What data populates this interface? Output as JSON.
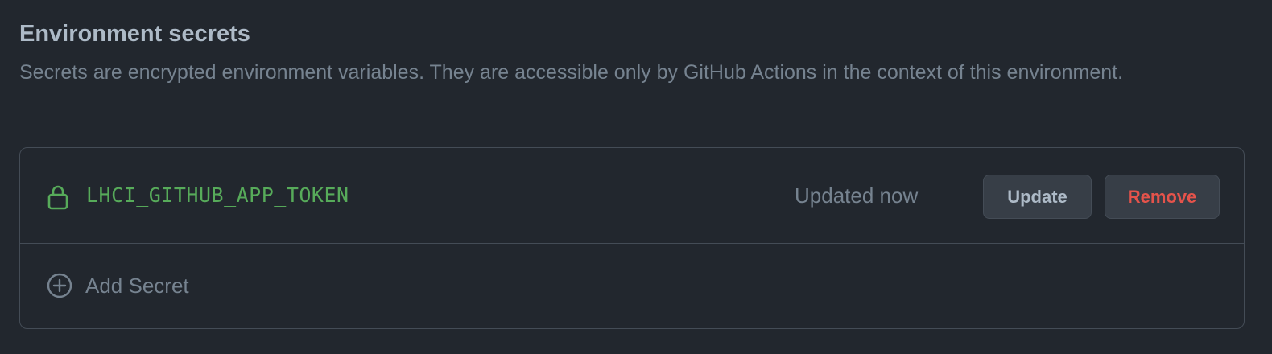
{
  "section": {
    "title": "Environment secrets",
    "description": "Secrets are encrypted environment variables. They are accessible only by GitHub Actions in the context of this environment."
  },
  "secrets": [
    {
      "name": "LHCI_GITHUB_APP_TOKEN",
      "status": "Updated now",
      "icon": "lock-icon",
      "update_label": "Update",
      "remove_label": "Remove"
    }
  ],
  "add": {
    "label": "Add Secret",
    "icon": "plus-circle-icon"
  },
  "colors": {
    "background": "#22272e",
    "border": "#444c56",
    "secret_name": "#57ab5a",
    "remove_text": "#e5534b",
    "muted_text": "#768390",
    "button_bg": "#373e47"
  }
}
